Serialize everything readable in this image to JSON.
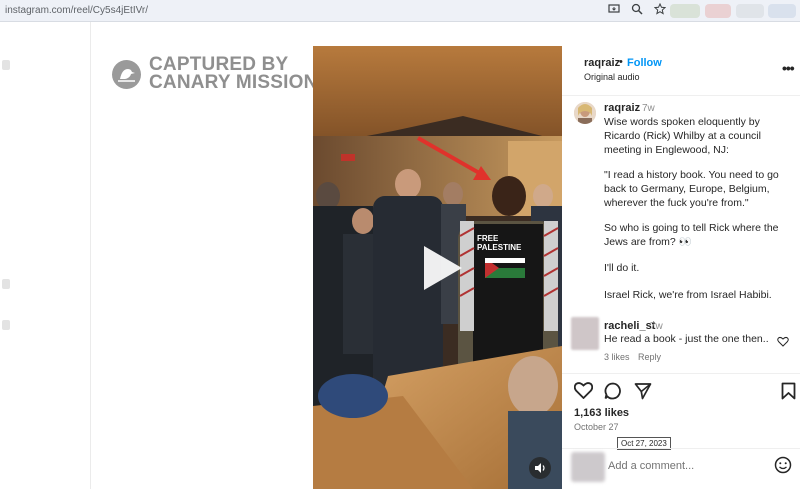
{
  "browser": {
    "url": "instagram.com/reel/Cy5s4jEtIVr/"
  },
  "watermark": {
    "line1": "CAPTURED BY",
    "line2": "CANARY MISSION"
  },
  "video": {
    "shirt_text": "FREE\nPALESTINE"
  },
  "header": {
    "username": "raqraiz",
    "separator": "•",
    "follow_label": "Follow",
    "audio": "Original audio",
    "more": "•••"
  },
  "caption": {
    "username": "raqraiz",
    "time": "7w",
    "p1": "Wise words spoken eloquently by Ricardo (Rick) Whilby at a council meeting in Englewood, NJ:",
    "p2": "\"I read a history book. You need to go back to Germany, Europe, Belgium, wherever the fuck you're from.\"",
    "p3": "So who is going to tell Rick where the Jews are from? 👀",
    "p4": "I'll do it.",
    "p5": "Israel Rick, we're from Israel Habibi."
  },
  "comment": {
    "username": "racheli_st",
    "time": "7w",
    "text": "He read a book - just the one then..",
    "likes": "3 likes",
    "reply": "Reply"
  },
  "stats": {
    "likes": "1,163 likes",
    "date": "October 27",
    "tooltip": "Oct 27, 2023"
  },
  "add_comment": {
    "placeholder": "Add a comment..."
  },
  "colors": {
    "follow": "#0095f6",
    "arrow": "#e0322b"
  }
}
